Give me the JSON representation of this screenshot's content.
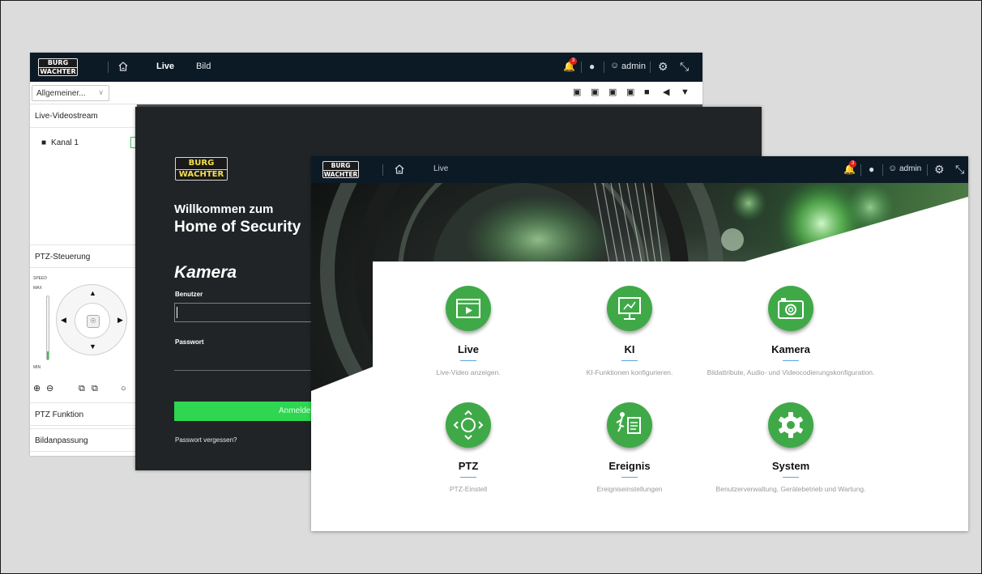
{
  "brand": {
    "logo_line1": "BURG",
    "logo_line2": "WACHTER"
  },
  "live_window": {
    "nav": {
      "live": "Live",
      "bild": "Bild"
    },
    "notification_count": "3",
    "user": "admin",
    "stream_selector": "Allgemeiner...",
    "panel_headers": {
      "live_stream": "Live-Videostream",
      "ptz_control": "PTZ-Steuerung",
      "ptz_function": "PTZ Funktion",
      "image_adjust": "Bildanpassung"
    },
    "channel": "Kanal 1",
    "speed": {
      "title": "SPEED",
      "max": "MAX",
      "min": "MIN"
    }
  },
  "login_window": {
    "welcome_line1": "Willkommen zum",
    "welcome_line2": "Home of Security",
    "product": "Kamera",
    "user_label": "Benutzer",
    "password_label": "Passwort",
    "login_button": "Anmelden",
    "forgot_link": "Passwort vergessen?"
  },
  "home_window": {
    "nav_live": "Live",
    "notification_count": "3",
    "user": "admin",
    "colors": {
      "tile_green": "#3fa948",
      "accent_line": "#5aa4e0"
    },
    "tiles": [
      {
        "icon": "live-monitor-icon",
        "title": "Live",
        "desc": "Live-Video anzeigen."
      },
      {
        "icon": "ai-config-icon",
        "title": "KI",
        "desc": "KI-Funktionen konfigurieren."
      },
      {
        "icon": "camera-icon",
        "title": "Kamera",
        "desc": "Bildattribute, Audio- und Videocodierungskonfiguration."
      },
      {
        "icon": "ptz-control-icon",
        "title": "PTZ",
        "desc": "PTZ-Einstell"
      },
      {
        "icon": "event-icon",
        "title": "Ereignis",
        "desc": "Ereigniseinstellungen"
      },
      {
        "icon": "gear-icon",
        "title": "System",
        "desc": "Benutzerverwaltung, Gerätebetrieb und Wartung."
      }
    ]
  }
}
